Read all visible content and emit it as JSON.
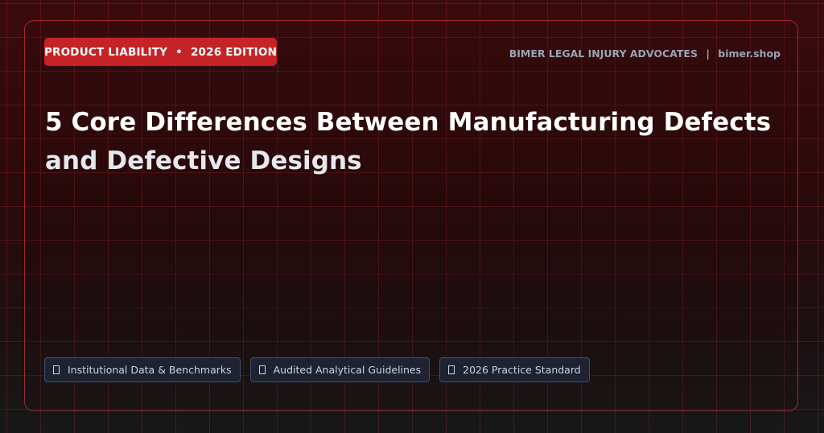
{
  "badge": {
    "category": "PRODUCT LIABILITY",
    "separator": "•",
    "edition": "2026 EDITION"
  },
  "brand": {
    "name": "BIMER LEGAL INJURY ADVOCATES",
    "separator": "|",
    "site": "bimer.shop"
  },
  "title": {
    "line1": "5 Core Differences Between Manufacturing Defects",
    "line2": "and Defective Designs"
  },
  "tags": [
    {
      "label": "Institutional Data & Benchmarks",
      "icon": "missing-glyph-icon"
    },
    {
      "label": "Audited Analytical Guidelines",
      "icon": "missing-glyph-icon"
    },
    {
      "label": "2026 Practice Standard",
      "icon": "missing-glyph-icon"
    }
  ],
  "colors": {
    "accent": "#c62326",
    "card_border": "#e23e3e",
    "tag_background": "#1d2332",
    "tag_border": "#3e506c",
    "brand_text": "#9aa3b6"
  }
}
